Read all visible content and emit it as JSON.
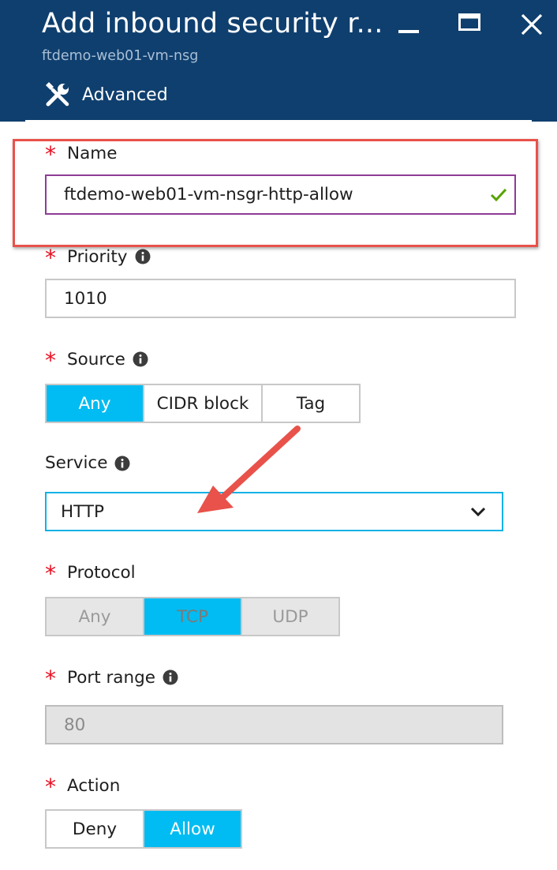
{
  "header": {
    "title": "Add inbound security r...",
    "subtitle": "ftdemo-web01-vm-nsg",
    "advanced_label": "Advanced"
  },
  "name_field": {
    "label": "Name",
    "value": "ftdemo-web01-vm-nsgr-http-allow",
    "required": true,
    "valid": true
  },
  "priority_field": {
    "label": "Priority",
    "value": "1010",
    "required": true
  },
  "source": {
    "label": "Source",
    "required": true,
    "options": [
      "Any",
      "CIDR block",
      "Tag"
    ],
    "selected": "Any"
  },
  "service": {
    "label": "Service",
    "value": "HTTP"
  },
  "protocol": {
    "label": "Protocol",
    "required": true,
    "options": [
      "Any",
      "TCP",
      "UDP"
    ],
    "selected": "TCP",
    "disabled": true
  },
  "port_range": {
    "label": "Port range",
    "value": "80",
    "required": true,
    "disabled": true
  },
  "action": {
    "label": "Action",
    "required": true,
    "options": [
      "Deny",
      "Allow"
    ],
    "selected": "Allow"
  },
  "colors": {
    "header_bg": "#0f3f6e",
    "accent": "#00bcf2",
    "required_star": "#e81123",
    "valid_check": "#57a300",
    "annotation": "#e8524a"
  },
  "icons": {
    "advanced": "tools-icon",
    "info": "info-icon",
    "dropdown": "chevron-down-icon",
    "valid": "checkmark-icon"
  }
}
